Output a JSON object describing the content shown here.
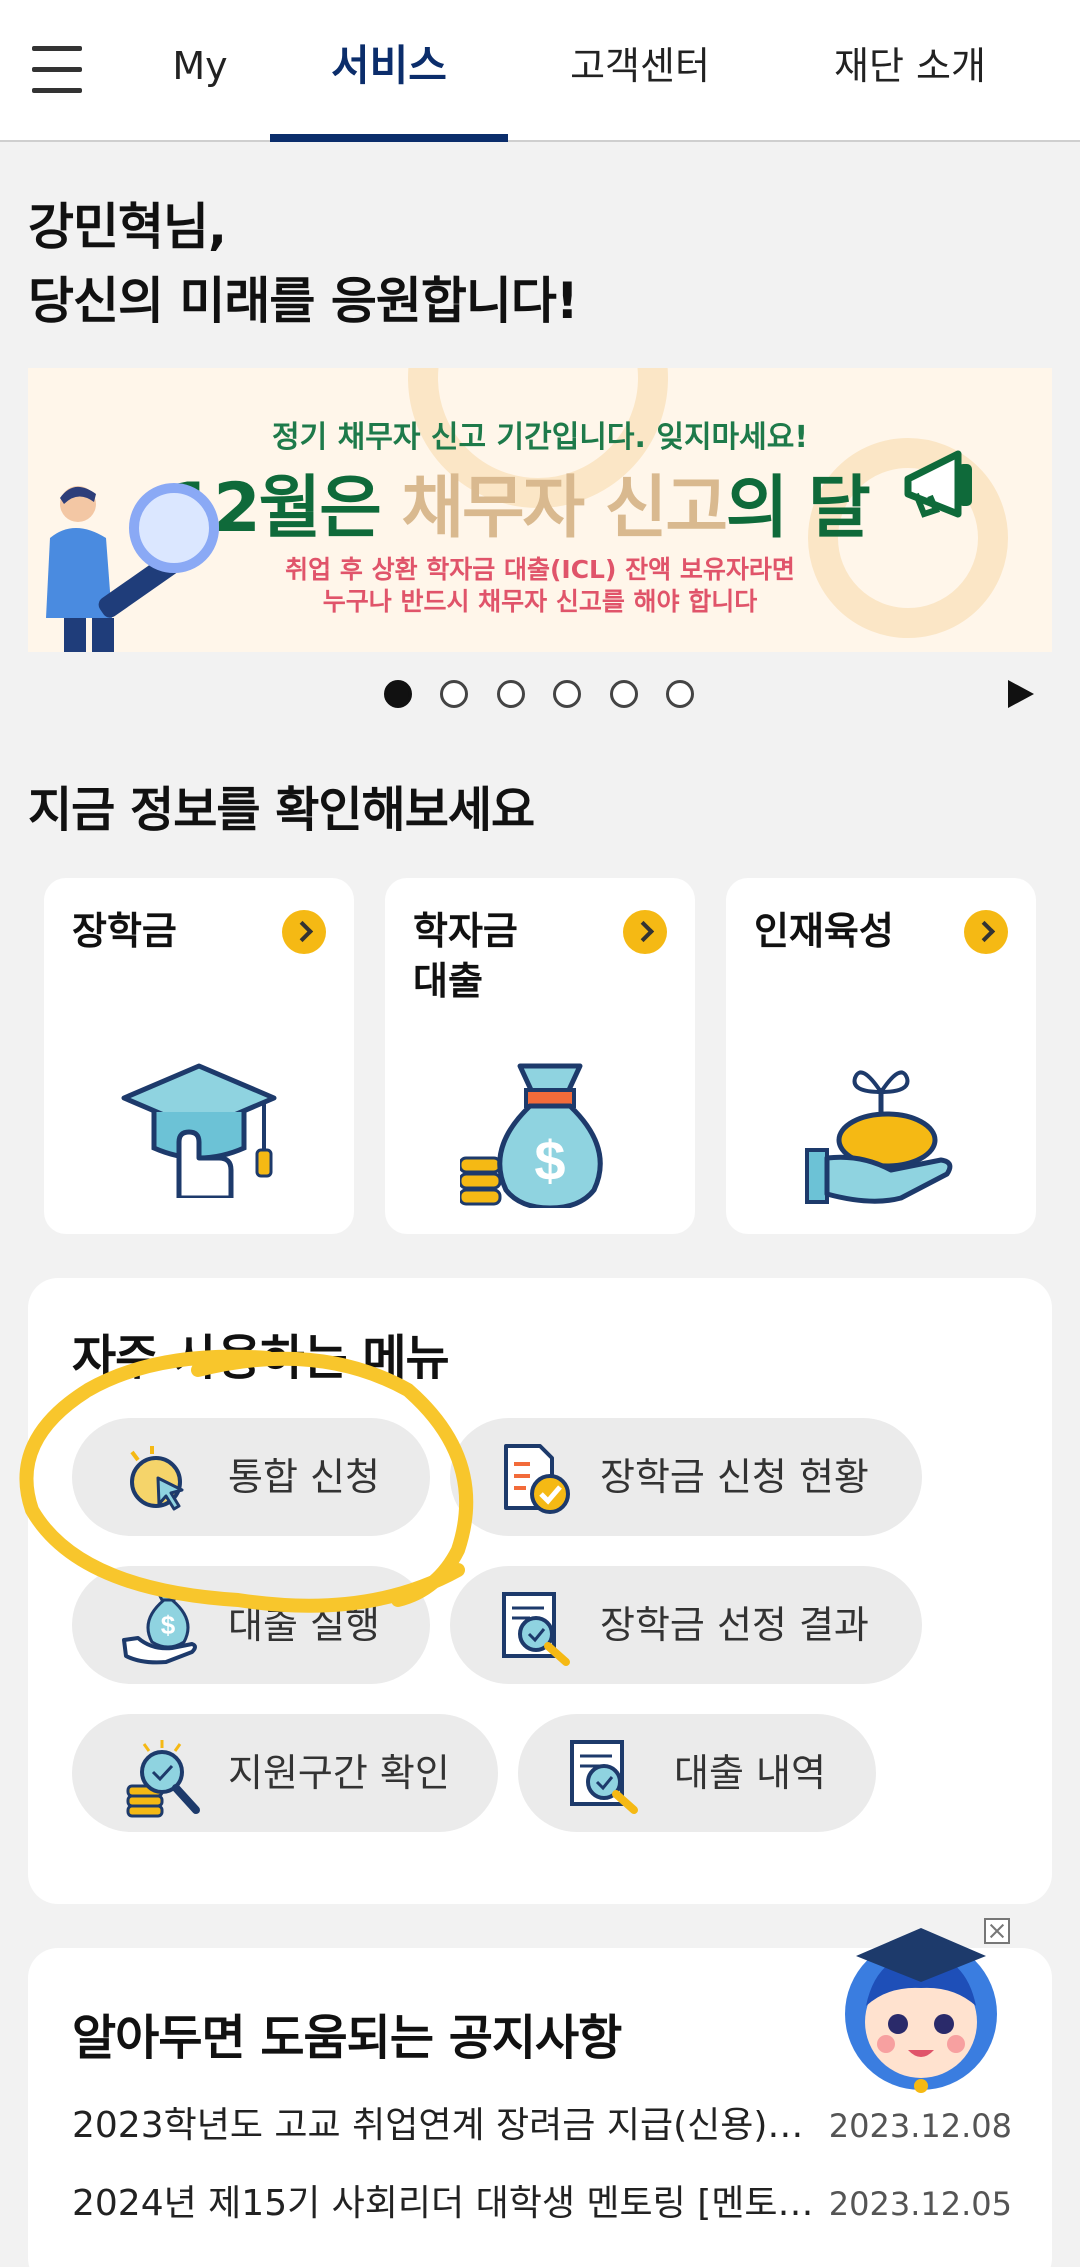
{
  "nav": {
    "tabs": [
      {
        "label": "My"
      },
      {
        "label": "서비스"
      },
      {
        "label": "고객센터"
      },
      {
        "label": "재단 소개"
      }
    ],
    "active_tab": "서비스",
    "accent_color": "#0b2d6b"
  },
  "greeting": {
    "line1": "강민혁님,",
    "line2": "당신의 미래를 응원합니다!"
  },
  "banner": {
    "line1": "정기 채무자 신고 기간입니다. 잊지마세요!",
    "title_part1": "12월은 ",
    "title_highlight": "채무자 신고",
    "title_part2": "의 달",
    "sub1": "취업 후 상환 학자금 대출(ICL) 잔액 보유자라면",
    "sub2": "누구나 반드시 채무자 신고를 해야 합니다"
  },
  "carousel": {
    "total_slides": 6,
    "active_index": 0,
    "play_icon": "play-icon"
  },
  "info_section": {
    "title": "지금 정보를 확인해보세요",
    "cards": [
      {
        "label": "장학금",
        "icon": "graduation-cap-icon"
      },
      {
        "label": "학자금\n대출",
        "icon": "money-bag-icon"
      },
      {
        "label": "인재육성",
        "icon": "sprout-hand-icon"
      }
    ]
  },
  "frequent_menu": {
    "title": "자주 사용하는 메뉴",
    "items": [
      {
        "label": "통합 신청",
        "icon": "cursor-click-icon"
      },
      {
        "label": "장학금 신청 현황",
        "icon": "document-check-icon"
      },
      {
        "label": "대출 실행",
        "icon": "money-hand-icon"
      },
      {
        "label": "장학금 선정 결과",
        "icon": "document-search-icon"
      },
      {
        "label": "지원구간 확인",
        "icon": "coins-search-icon"
      },
      {
        "label": "대출 내역",
        "icon": "document-magnifier-icon"
      }
    ]
  },
  "notices": {
    "title": "알아두면 도움되는 공지사항",
    "items": [
      {
        "title": "2023학년도 고교 취업연계 장려금 지급(신용)…",
        "date": "2023.12.08"
      },
      {
        "title": "2024년 제15기 사회리더 대학생 멘토링 [멘토…",
        "date": "2023.12.05"
      }
    ]
  }
}
